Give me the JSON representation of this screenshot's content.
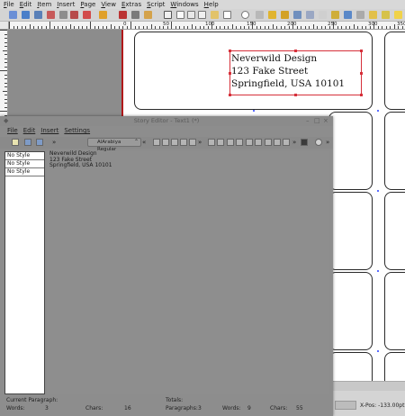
{
  "app": {
    "menu": [
      "File",
      "Edit",
      "Item",
      "Insert",
      "Page",
      "View",
      "Extras",
      "Script",
      "Windows",
      "Help"
    ]
  },
  "ruler": {
    "numbers": [
      "0",
      "50",
      "100",
      "150",
      "200",
      "250",
      "300",
      "350"
    ]
  },
  "document": {
    "address_lines": [
      "Neverwild Design",
      "123 Fake Street",
      "Springfield, USA 10101"
    ]
  },
  "story_editor": {
    "title": "Story Editor - Text1 (*)",
    "menu": [
      "File",
      "Edit",
      "Insert",
      "Settings"
    ],
    "font": "AlArabiya Regular",
    "styles": [
      "No Style",
      "No Style",
      "No Style"
    ],
    "lines": [
      "Neverwild Design",
      "123 Fake Street",
      "Springfield, USA 10101"
    ],
    "status": {
      "current_paragraph_label": "Current Paragraph:",
      "totals_label": "Totals:",
      "words_label": "Words:",
      "words_value": "3",
      "chars_label": "Chars:",
      "chars_value": "16",
      "paragraphs_label": "Paragraphs:",
      "paragraphs_value": "3",
      "total_words_label": "Words:",
      "total_words_value": "9",
      "total_chars_label": "Chars:",
      "total_chars_value": "55"
    }
  },
  "status": {
    "xpos": "X-Pos: -133.00pt"
  },
  "colors": {
    "frame_red": "#d6303a",
    "page_white": "#ffffff",
    "margin_red": "#b1181a",
    "label_stroke": "#2a2a2a"
  }
}
